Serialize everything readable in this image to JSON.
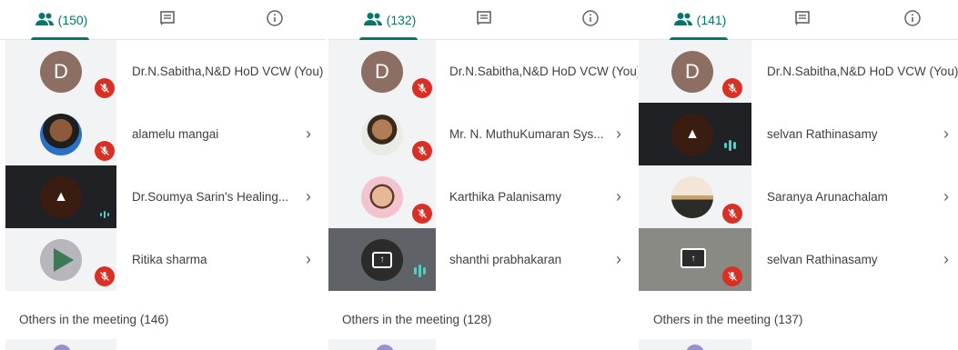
{
  "panels": [
    {
      "tabs": {
        "people_count": "(150)"
      },
      "participants": [
        {
          "name": "Dr.N.Sabitha,N&D HoD VCW (You)",
          "avatar_letter": "D"
        },
        {
          "name": "alamelu mangai"
        },
        {
          "name": "Dr.Soumya Sarin's Healing..."
        },
        {
          "name": "Ritika sharma"
        }
      ],
      "others_label": "Others in the meeting (146)"
    },
    {
      "tabs": {
        "people_count": "(132)"
      },
      "participants": [
        {
          "name": "Dr.N.Sabitha,N&D HoD VCW (You)",
          "avatar_letter": "D"
        },
        {
          "name": "Mr. N. MuthuKumaran Sys..."
        },
        {
          "name": "Karthika Palanisamy"
        },
        {
          "name": "shanthi prabhakaran"
        }
      ],
      "others_label": "Others in the meeting (128)"
    },
    {
      "tabs": {
        "people_count": "(141)"
      },
      "participants": [
        {
          "name": "Dr.N.Sabitha,N&D HoD VCW (You)",
          "avatar_letter": "D"
        },
        {
          "name": "selvan Rathinasamy"
        },
        {
          "name": "Saranya Arunachalam"
        },
        {
          "name": "selvan Rathinasamy"
        }
      ],
      "others_label": "Others in the meeting (137)"
    }
  ],
  "icons": {
    "people": "people-icon",
    "chat": "chat-icon",
    "info": "info-icon",
    "mic_off": "mic-off-icon",
    "audio_level": "audio-level-icon",
    "chevron": "chevron-right-icon",
    "pin": "pin-icon",
    "present": "presenting-icon"
  },
  "colors": {
    "accent": "#00796b",
    "mute": "#d93025",
    "audio": "#4ecdc4"
  }
}
